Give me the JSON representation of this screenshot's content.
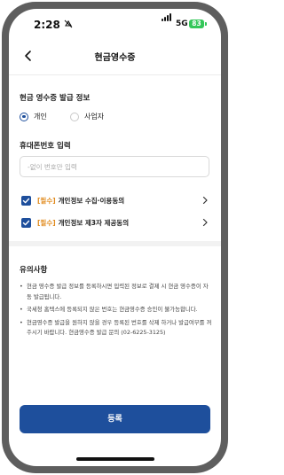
{
  "status_bar": {
    "time": "2:28",
    "network": "5G",
    "battery": "83"
  },
  "header": {
    "title": "현금영수증"
  },
  "receipt_type": {
    "heading": "현금 영수증 발급 정보",
    "options": [
      {
        "label": "개인",
        "selected": true
      },
      {
        "label": "사업자",
        "selected": false
      }
    ]
  },
  "phone": {
    "heading": "휴대폰번호 입력",
    "placeholder": "-없이 번호만 입력",
    "value": ""
  },
  "agreements": [
    {
      "tag": "[필수]",
      "text": "개인정보 수집·이용동의",
      "checked": true
    },
    {
      "tag": "[필수]",
      "text": "개인정보 제3자 제공동의",
      "checked": true
    }
  ],
  "notice": {
    "heading": "유의사항",
    "items": [
      "현금 영수증 발급 정보를 등록하시면 입력된 정보로 결제 시 현금 영수증이 자동 발급됩니다.",
      "국세청 홈텍스에 등록되지 않은 번호는 현금영수증 승인이 불가능합니다.",
      "현금영수증 발급을 원하지 않을 경우 등록된 번호를 삭제 하거나 발급여부를 꺼주시기 바랍니다. 현금영수증 발급 문의 (02-6225-3125)"
    ]
  },
  "submit": {
    "label": "등록"
  },
  "colors": {
    "accent": "#1e4f9c",
    "required": "#e08a1c",
    "battery": "#34c759",
    "bezel": "#5e5e5e"
  }
}
